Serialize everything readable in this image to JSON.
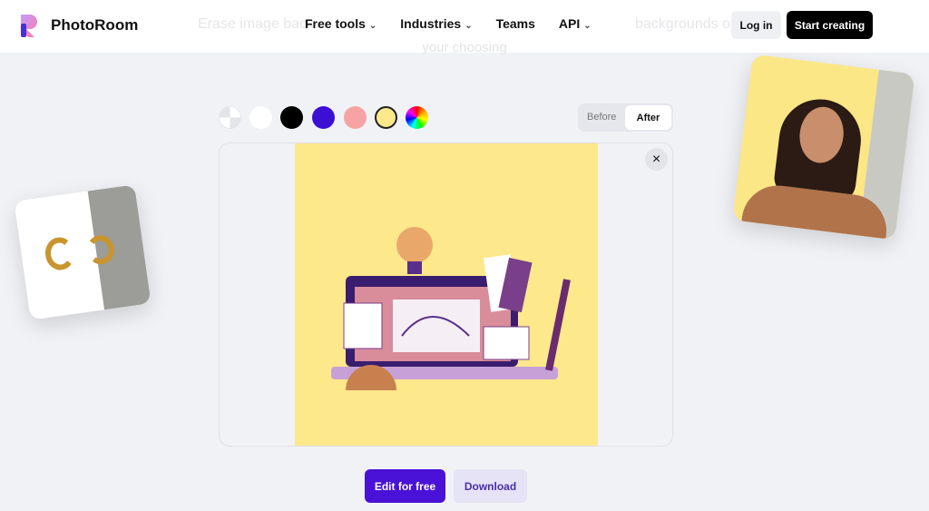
{
  "header": {
    "brand": "PhotoRoom",
    "nav": [
      {
        "label": "Free tools",
        "dropdown": true
      },
      {
        "label": "Industries",
        "dropdown": true
      },
      {
        "label": "Teams",
        "dropdown": false
      },
      {
        "label": "API",
        "dropdown": true
      }
    ],
    "login": "Log in",
    "start": "Start creating"
  },
  "hero_faded": {
    "left": "Erase image back",
    "right": "backgrounds of",
    "line2": "your choosing"
  },
  "swatches": [
    {
      "name": "transparent",
      "color": "#e9eaee"
    },
    {
      "name": "white",
      "color": "#ffffff"
    },
    {
      "name": "black",
      "color": "#000000"
    },
    {
      "name": "purple",
      "color": "#3d0fd4"
    },
    {
      "name": "pink",
      "color": "#f7a3a3"
    },
    {
      "name": "yellow",
      "color": "#fde88c",
      "selected": true
    },
    {
      "name": "custom",
      "color": "rainbow"
    }
  ],
  "toggle": {
    "before": "Before",
    "after": "After",
    "active": "After"
  },
  "actions": {
    "edit": "Edit for free",
    "download": "Download"
  }
}
